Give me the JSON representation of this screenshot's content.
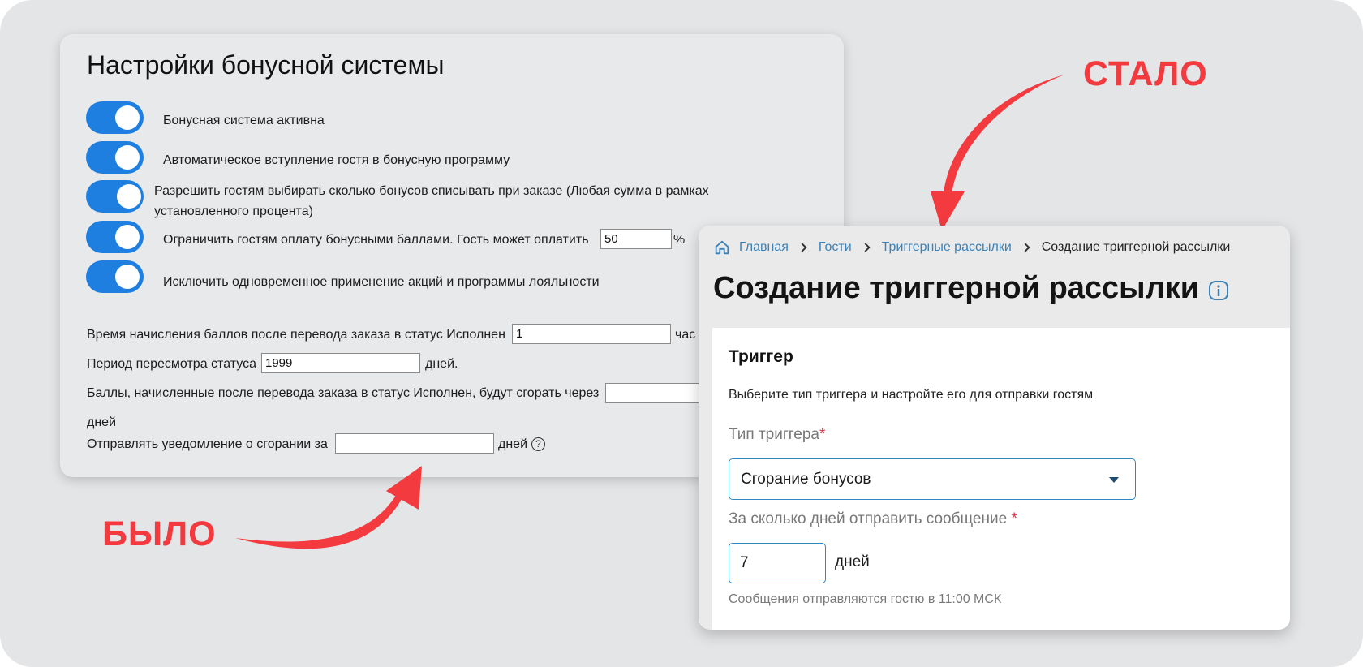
{
  "labels": {
    "before": "БЫЛО",
    "after": "СТАЛО"
  },
  "colors": {
    "accent_red": "#f23a3f",
    "toggle_blue": "#1e7fe0",
    "link_blue": "#3a82b7",
    "field_border": "#2f86c3"
  },
  "old_settings": {
    "title": "Настройки бонусной системы",
    "options": [
      {
        "label": "Бонусная система активна",
        "enabled": true
      },
      {
        "label": "Автоматическое вступление гостя в бонусную программу",
        "enabled": true
      },
      {
        "label": "Разрешить гостям выбирать сколько бонусов списывать при заказе (Любая сумма в рамках установленного процента)",
        "enabled": true
      },
      {
        "label": "Ограничить гостям оплату бонусными баллами. Гость может оплатить",
        "enabled": true,
        "value": "50",
        "suffix": "%"
      },
      {
        "label": "Исключить одновременное применение акций и программы лояльности",
        "enabled": true
      }
    ],
    "accrual_time": {
      "label": "Время начисления баллов после перевода заказа в статус Исполнен",
      "value": "1",
      "suffix": "час"
    },
    "review_period": {
      "label": "Период пересмотра статуса",
      "value": "1999",
      "suffix": "дней."
    },
    "expiry": {
      "label": "Баллы, начисленные после перевода заказа в статус Исполнен, будут сгорать через",
      "value": "",
      "suffix": "дней"
    },
    "notify": {
      "label": "Отправлять уведомление о сгорании за",
      "value": "",
      "suffix": "дней",
      "help_icon": "question-circle-icon"
    }
  },
  "new_page": {
    "breadcrumbs": {
      "home_icon": "home-icon",
      "items": [
        "Главная",
        "Гости",
        "Триггерные рассылки"
      ],
      "current": "Создание триггерной рассылки"
    },
    "title": "Создание триггерной рассылки",
    "info_icon": "info-icon",
    "card": {
      "heading": "Триггер",
      "description": "Выберите тип триггера и настройте его для отправки гостям",
      "trigger_type": {
        "label": "Тип триггера",
        "required_mark": "*",
        "selected": "Сгорание бонусов"
      },
      "days_before": {
        "label": "За сколько дней отправить сообщение",
        "required_mark": "*",
        "value": "7",
        "unit": "дней"
      },
      "hint": "Сообщения отправляются гостю в 11:00 МСК"
    }
  }
}
